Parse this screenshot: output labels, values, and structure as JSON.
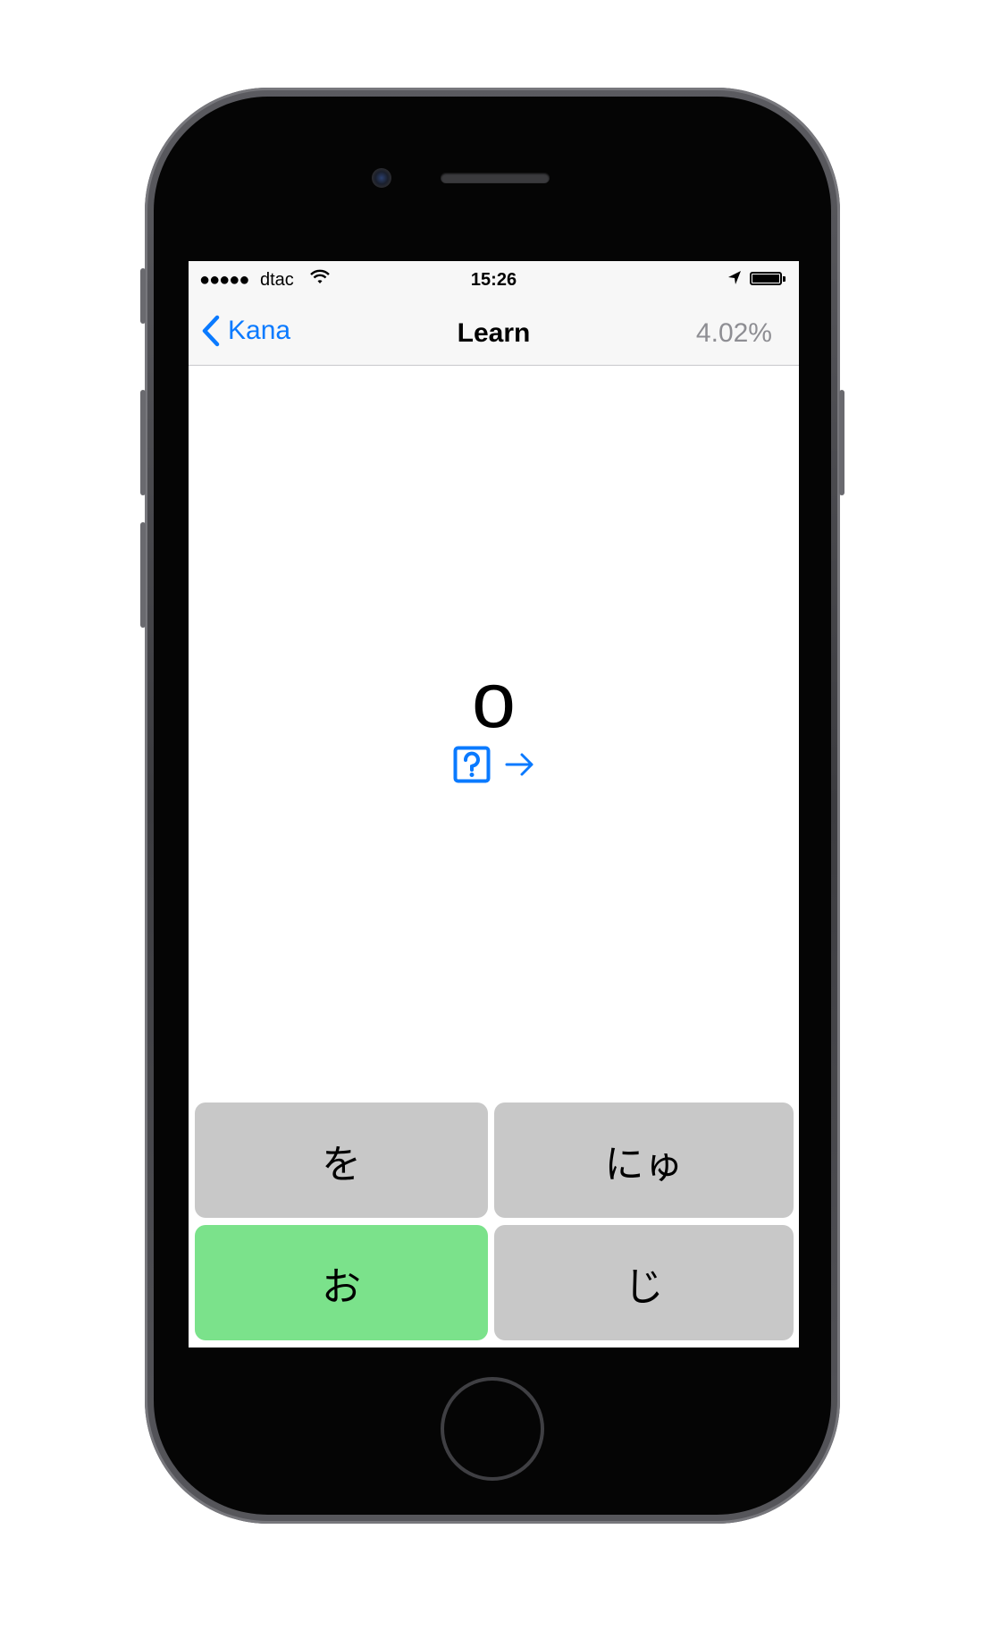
{
  "status_bar": {
    "signal": "●●●●●",
    "carrier": "dtac",
    "time": "15:26"
  },
  "nav": {
    "back_label": "Kana",
    "title": "Learn",
    "progress": "4.02%"
  },
  "prompt": {
    "romaji": "o"
  },
  "answers": [
    {
      "label": "を",
      "state": "neutral"
    },
    {
      "label": "にゅ",
      "state": "neutral"
    },
    {
      "label": "お",
      "state": "correct"
    },
    {
      "label": "じ",
      "state": "neutral"
    }
  ],
  "colors": {
    "accent": "#0a7aff",
    "correct": "#7be28b",
    "neutral": "#c8c8c8"
  },
  "icons": {
    "back": "chevron-left-icon",
    "hint": "question-square-icon",
    "skip": "arrow-right-icon",
    "wifi": "wifi-icon",
    "location": "location-arrow-icon",
    "battery": "battery-icon"
  }
}
